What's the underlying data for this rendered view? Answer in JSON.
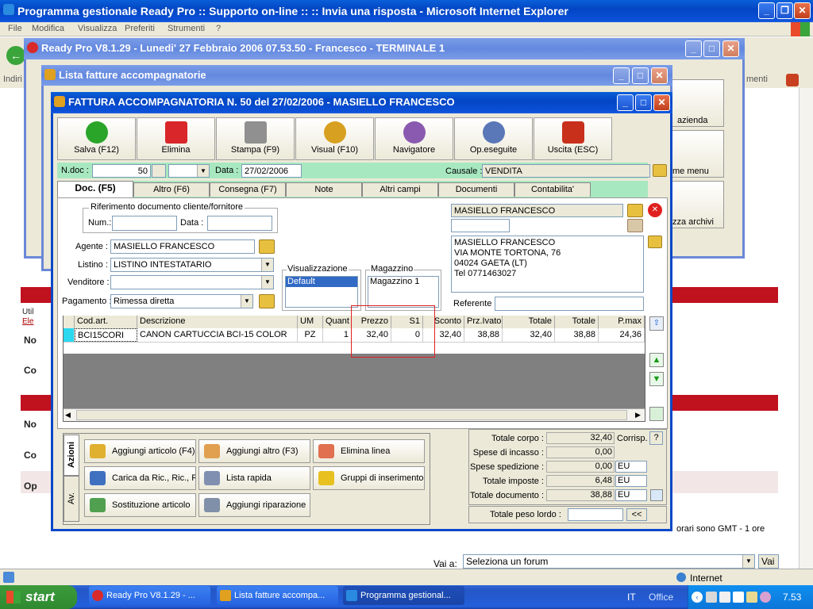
{
  "ie": {
    "title": "Programma gestionale Ready Pro :: Supporto on-line :: :: Invia una risposta - Microsoft Internet Explorer",
    "menu": [
      "File",
      "Modifica",
      "Visualizza",
      "Preferiti",
      "Strumenti",
      "?"
    ],
    "addr_label": "Indiri",
    "right_link": "menti",
    "status": "Internet",
    "forum_label": "Vai a:",
    "forum_select": "Seleziona un forum",
    "go": "Vai",
    "bg_text": [
      "Util",
      "Ele",
      "No",
      "Co",
      "No",
      "Co",
      "Op"
    ],
    "tz_text": "orari sono GMT - 1 ore"
  },
  "rp": {
    "title": "Ready Pro V8.1.29 - Lunedi' 27 Febbraio 2006  07.53.50 - Francesco - TERMINALE 1",
    "side_buttons": [
      "azienda",
      "me menu",
      "zza archivi"
    ]
  },
  "lista": {
    "title": "Lista fatture accompagnatorie"
  },
  "fattura": {
    "title": "FATTURA ACCOMPAGNATORIA N. 50  del 27/02/2006 - MASIELLO FRANCESCO"
  },
  "toolbar": [
    {
      "label": "Salva (F12)",
      "color": "#2aa52a"
    },
    {
      "label": "Elimina",
      "color": "#d8262a"
    },
    {
      "label": "Stampa (F9)",
      "color": "#909090"
    },
    {
      "label": "Visual (F10)",
      "color": "#d8a020"
    },
    {
      "label": "Navigatore",
      "color": "#8a5ab0"
    },
    {
      "label": "Op.eseguite",
      "color": "#5a78b8"
    },
    {
      "label": "Uscita (ESC)",
      "color": "#c8301c"
    }
  ],
  "header": {
    "ndoc_label": "N.doc :",
    "ndoc": "50",
    "data_label": "Data :",
    "data": "27/02/2006",
    "causale_label": "Causale :",
    "causale": "VENDITA"
  },
  "tabs": [
    "Doc. (F5)",
    "Altro (F6)",
    "Consegna (F7)",
    "Note",
    "Altri campi",
    "Documenti",
    "Contabilita'"
  ],
  "doc": {
    "rif_title": "Riferimento documento cliente/fornitore",
    "num_label": "Num.:",
    "data_label": "Data :",
    "agente_label": "Agente :",
    "agente": "MASIELLO FRANCESCO",
    "listino_label": "Listino :",
    "listino": "LISTINO INTESTATARIO",
    "venditore_label": "Venditore :",
    "pagamento_label": "Pagamento :",
    "pagamento": "Rimessa diretta",
    "visual_title": "Visualizzazione",
    "visual_item": "Default",
    "mag_title": "Magazzino",
    "mag_item": "Magazzino 1",
    "cliente": "MASIELLO FRANCESCO",
    "address": [
      "MASIELLO FRANCESCO",
      "VIA MONTE TORTONA, 76",
      "04024 GAETA (LT)",
      "Tel 0771463027"
    ],
    "referente_label": "Referente"
  },
  "grid": {
    "headers": [
      "Cod.art.",
      "Descrizione",
      "UM",
      "Quant",
      "Prezzo",
      "S1",
      "Sconto",
      "Prz.Ivato",
      "Totale",
      "Totale",
      "P.max"
    ],
    "row": [
      "BCI15CORI",
      "CANON CARTUCCIA BCI-15 COLOR",
      "PZ",
      "1",
      "32,40",
      "0",
      "32,40",
      "38,88",
      "32,40",
      "38,88",
      "24,36"
    ]
  },
  "actions": {
    "side_tabs": [
      "Azioni",
      "Av."
    ],
    "buttons": [
      "Aggiungi articolo (F4)",
      "Aggiungi altro (F3)",
      "Elimina linea",
      "Carica da Ric., Ric., Ri",
      "Lista rapida",
      "Gruppi di inserimento",
      "Sostituzione articolo",
      "Aggiungi riparazione"
    ]
  },
  "totals": {
    "rows": [
      {
        "label": "Totale corpo :",
        "value": "32,40",
        "extra": "Corrisp."
      },
      {
        "label": "Spese di incasso :",
        "value": "0,00",
        "extra": ""
      },
      {
        "label": "Spese spedizione :",
        "value": "0,00",
        "extra": "EU"
      },
      {
        "label": "Totale imposte :",
        "value": "6,48",
        "extra": "EU"
      },
      {
        "label": "Totale documento :",
        "value": "38,88",
        "extra": "EU"
      }
    ],
    "help": "?",
    "peso_label": "Totale peso lordo :",
    "peso_btn": "<<"
  },
  "taskbar": {
    "start": "start",
    "items": [
      "Ready Pro V8.1.29 - ...",
      "Lista fatture accompa...",
      "Programma gestional..."
    ],
    "lang": "IT",
    "office": "Office",
    "clock": "7.53"
  }
}
